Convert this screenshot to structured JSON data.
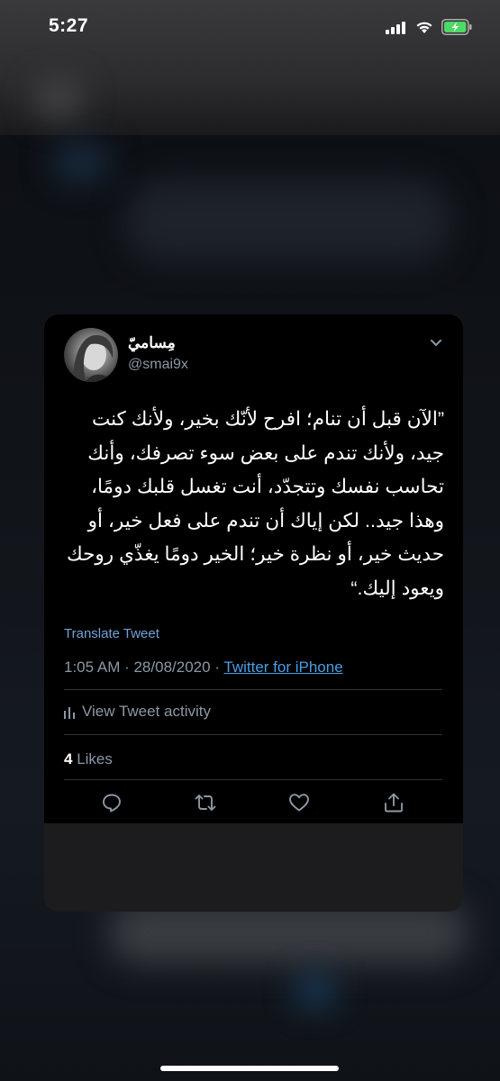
{
  "status_bar": {
    "time": "5:27"
  },
  "tweet": {
    "display_name": "مِساميّ",
    "handle": "@smai9x",
    "text": "”الآن قبل أن تنام؛ افرح لأنّك بخير، ولأنك كنت جيد، ولأنك تندم على بعض سوء تصرفك، وأنك تحاسب نفسك وتتجدّد، أنت تغسل قلبك دومًا، وهذا جيد.. لكن إياك أن تندم على فعل خير، أو حديث خير، أو نظرة خير؛ الخير دومًا يغذّي روحك ويعود إليك.“",
    "translate_label": "Translate Tweet",
    "timestamp": "1:05 AM · 28/08/2020 · ",
    "via": "Twitter for iPhone",
    "activity_label": "View Tweet activity",
    "likes_count": "4",
    "likes_label": " Likes"
  },
  "icons": {
    "reply": "reply-icon",
    "retweet": "retweet-icon",
    "like": "like-icon",
    "share": "share-icon"
  },
  "colors": {
    "link": "#4b9fe8",
    "secondary_text": "#8b98a5",
    "card_background": "#000000"
  }
}
